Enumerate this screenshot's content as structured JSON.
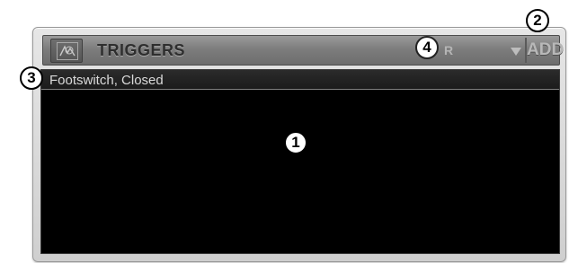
{
  "panel": {
    "title": "TRIGGERS",
    "selector": {
      "value": "R"
    },
    "add_label": "ADD"
  },
  "list": {
    "items": [
      {
        "label": "Footswitch, Closed"
      }
    ]
  },
  "callouts": {
    "c1": "1",
    "c2": "2",
    "c3": "3",
    "c4": "4"
  },
  "colors": {
    "panel_bg": "#d9d9d9",
    "header_bg": "#7d7d7d",
    "list_bg": "#000000",
    "row_text": "#d9d9d9"
  },
  "icons": {
    "logo": "lightbulb-waveform-icon",
    "dropdown": "triangle-down-icon"
  }
}
